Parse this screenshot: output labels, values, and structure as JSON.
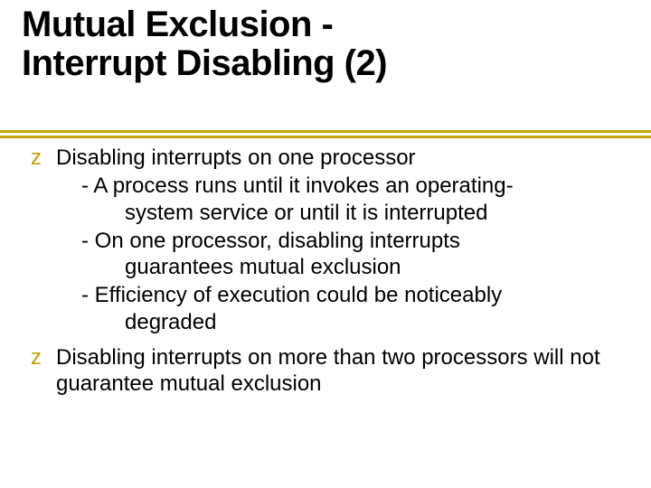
{
  "title_line1": "Mutual Exclusion -",
  "title_line2": "Interrupt Disabling (2)",
  "items": [
    {
      "bullet": "z",
      "text": "Disabling interrupts on one processor",
      "subitems": [
        {
          "l1": "- A process runs until it invokes an operating-",
          "l2": "system service or until it is interrupted"
        },
        {
          "l1": "- On one processor, disabling interrupts",
          "l2": "guarantees mutual exclusion"
        },
        {
          "l1": "- Efficiency of execution could be noticeably",
          "l2": "degraded"
        }
      ]
    },
    {
      "bullet": "z",
      "text": "Disabling interrupts on more than two processors will not guarantee mutual exclusion"
    }
  ]
}
